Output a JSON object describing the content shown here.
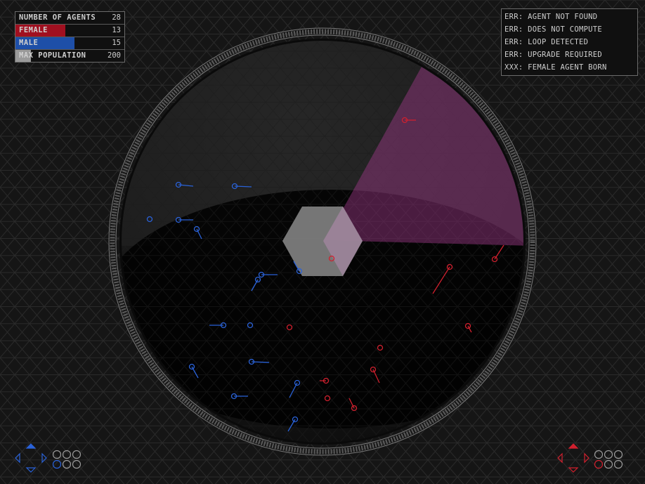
{
  "stats": {
    "agents": {
      "label": "NUMBER OF AGENTS",
      "value": "28"
    },
    "female": {
      "label": "FEMALE",
      "value": "13",
      "fraction": 0.46,
      "color": "#a01020"
    },
    "male": {
      "label": "MALE",
      "value": "15",
      "fraction": 0.54,
      "color": "#1e4fa8"
    },
    "max_population": {
      "label": "MAX POPULATION",
      "value": "200",
      "fraction": 0.14,
      "color": "#9a9a9a"
    }
  },
  "log": [
    "ERR: AGENT NOT FOUND",
    "ERR: DOES NOT COMPUTE",
    "ERR: LOOP DETECTED",
    "ERR: UPGRADE REQUIRED",
    "XXX: FEMALE AGENT BORN"
  ],
  "colors": {
    "female": "#d0202e",
    "male": "#2a62d8",
    "view_cone": "#a03a8a"
  },
  "controls": {
    "left": {
      "icon": "dpad-icon",
      "color": "#2a62d8"
    },
    "right": {
      "icon": "dpad-icon",
      "color": "#d0202e"
    }
  }
}
